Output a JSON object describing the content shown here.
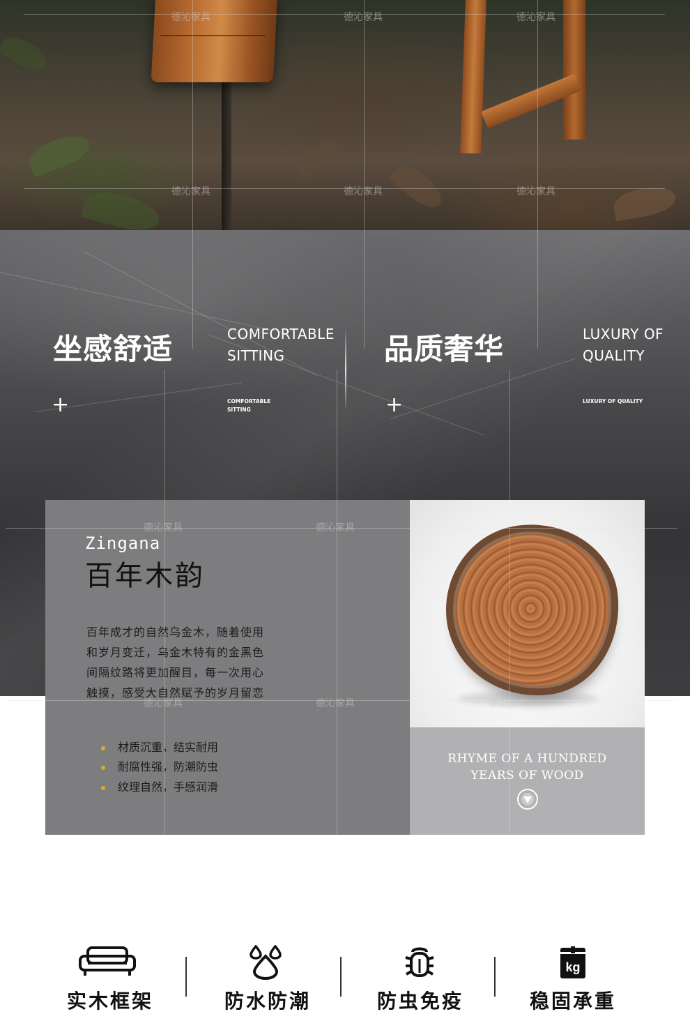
{
  "watermark": "德沁家具",
  "features": [
    {
      "title_cn": "坐感舒适",
      "title_en_1": "COMFORTABLE",
      "title_en_2": "SITTING",
      "small_1": "COMFORTABLE",
      "small_2": "SITTING",
      "plus": "+"
    },
    {
      "title_cn": "品质奢华",
      "title_en_1": "LUXURY OF",
      "title_en_2": "QUALITY",
      "small_1": "LUXURY OF QUALITY",
      "plus": "+"
    }
  ],
  "zingana": {
    "brand": "Zingana",
    "title": "百年木韵",
    "paragraph_lines": [
      "百年成才的自然乌金木，随着使用",
      "和岁月变迁，乌金木特有的金黑色",
      "间隔纹路将更加醒目，每一次用心",
      "触摸，感受大自然赋予的岁月留恋"
    ],
    "bullets": [
      "材质沉重，结实耐用",
      "耐腐性强，防潮防虫",
      "纹理自然，手感润滑"
    ],
    "rhyme_1": "RHYME OF A HUNDRED",
    "rhyme_2": "YEARS OF WOOD"
  },
  "bottom_features": [
    {
      "icon": "sofa-icon",
      "label": "实木框架"
    },
    {
      "icon": "water-drops-icon",
      "label": "防水防潮"
    },
    {
      "icon": "bug-icon",
      "label": "防虫免疫"
    },
    {
      "icon": "kg-weight-icon",
      "label": "稳固承重"
    }
  ],
  "colors": {
    "dark_band": "#3e3e40",
    "card_gray": "#7d7d7f",
    "bullet_yellow": "#d4b21e",
    "wood": "#b06a3c"
  }
}
